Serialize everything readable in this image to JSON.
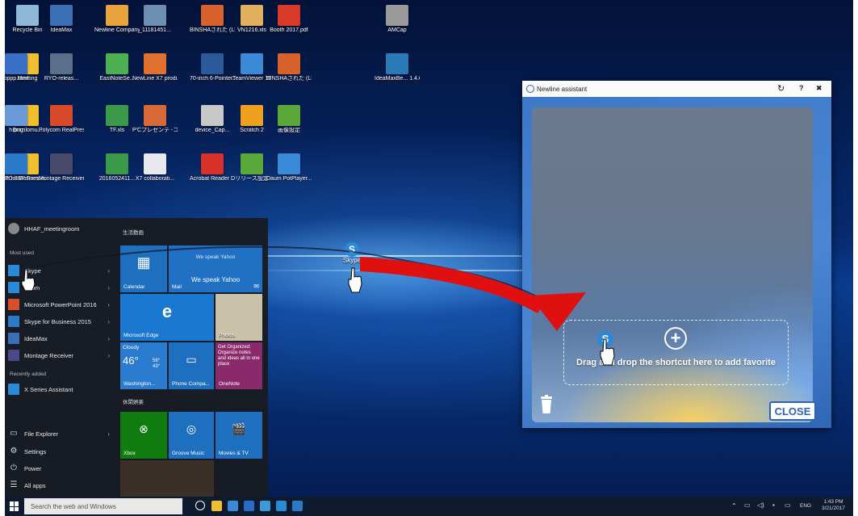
{
  "desktop": {
    "icons": [
      {
        "label": "Recycle Bin",
        "color": "#8fb8d8",
        "col": 0,
        "row": 0
      },
      {
        "label": "IdeaMax",
        "color": "#3a6fb5",
        "col": 1,
        "row": 0
      },
      {
        "label": "Newline Company l...",
        "color": "#e8a33c",
        "col": 2,
        "row": 0
      },
      {
        "label": "_11181451...",
        "color": "#6c8fb0",
        "col": 3,
        "row": 0
      },
      {
        "label": "BINSHAされた (LBG)",
        "color": "#d8622b",
        "col": 4,
        "row": 0
      },
      {
        "label": "VN1216.xls",
        "color": "#e0b060",
        "col": 5,
        "row": 0
      },
      {
        "label": "Booth 2017.pdf",
        "color": "#d83a2a",
        "col": 6,
        "row": 0
      },
      {
        "label": "AMCap",
        "color": "#9a9a9a",
        "col": 8,
        "row": 0
      },
      {
        "label": "Meeting",
        "color": "#f0c030",
        "col": 0,
        "row": 1
      },
      {
        "label": "RYO-releas...",
        "color": "#5a6f8a",
        "col": 1,
        "row": 1
      },
      {
        "label": "EastNoteSe...",
        "color": "#4caf50",
        "col": 2,
        "row": 1
      },
      {
        "label": "NewLine X7 product kit...",
        "color": "#e07030",
        "col": 3,
        "row": 1
      },
      {
        "label": "70-inch 6-Pointer...",
        "color": "#2a5a9a",
        "col": 4,
        "row": 1
      },
      {
        "label": "TeamViewer 12",
        "color": "#3a8ad8",
        "col": 5,
        "row": 1
      },
      {
        "label": "BINSHAされた (LBG)",
        "color": "#d8622b",
        "col": 6,
        "row": 1
      },
      {
        "label": "pppp.html",
        "color": "#3a6fc8",
        "col": 7,
        "row": 1
      },
      {
        "label": "IdeaMaxBe... 1.4.6.2016...",
        "color": "#2a7ab8",
        "col": 8,
        "row": 1
      },
      {
        "label": "Brazilomu...",
        "color": "#f0c030",
        "col": 0,
        "row": 2
      },
      {
        "label": "Polycom RealPresen...",
        "color": "#d84a2a",
        "col": 1,
        "row": 2
      },
      {
        "label": "TF.xls",
        "color": "#3a9a4a",
        "col": 2,
        "row": 2
      },
      {
        "label": "P'Cプレゼンテ -コンコ 2.pptx",
        "color": "#d86a3a",
        "col": 3,
        "row": 2
      },
      {
        "label": "device_Cap...",
        "color": "#c8c8c8",
        "col": 4,
        "row": 2
      },
      {
        "label": "Scratch 2",
        "color": "#f0a020",
        "col": 5,
        "row": 2
      },
      {
        "label": "画像設定",
        "color": "#5aa83a",
        "col": 6,
        "row": 2
      },
      {
        "label": "h.png",
        "color": "#6a9ad8",
        "col": 7,
        "row": 2
      },
      {
        "label": "TC-3BP Firmwa...",
        "color": "#f0c030",
        "col": 0,
        "row": 3
      },
      {
        "label": "Montage Receiver",
        "color": "#4a4a6a",
        "col": 1,
        "row": 3
      },
      {
        "label": "2016052411...",
        "color": "#3a9a4a",
        "col": 2,
        "row": 3
      },
      {
        "label": "X7 collaborati...",
        "color": "#e8e8f0",
        "col": 3,
        "row": 3
      },
      {
        "label": "Acrobat Reader DC",
        "color": "#d8302a",
        "col": 4,
        "row": 3
      },
      {
        "label": "リリース設定",
        "color": "#5aa83a",
        "col": 5,
        "row": 3
      },
      {
        "label": "Daum PotPlayer...",
        "color": "#3a8ad8",
        "col": 6,
        "row": 3
      },
      {
        "label": "Skype for Business 2015",
        "color": "#2a7ac8",
        "col": 7,
        "row": 3
      }
    ],
    "dragged_icon_label": "Skype"
  },
  "start_menu": {
    "user": "HHAF_meetingroom",
    "most_used_header": "Most used",
    "recently_added_header": "Recently added",
    "items": [
      {
        "label": "Skype",
        "color": "#2a8ad8",
        "arrow": "›"
      },
      {
        "label": "Zoom",
        "color": "#2a8ad8",
        "arrow": "›"
      },
      {
        "label": "Microsoft PowerPoint 2016",
        "color": "#d8502a",
        "arrow": "›"
      },
      {
        "label": "Skype for Business 2015",
        "color": "#2a7ac8",
        "arrow": "›"
      },
      {
        "label": "IdeaMax",
        "color": "#3a6fb5",
        "arrow": "›"
      },
      {
        "label": "Montage Receiver",
        "color": "#4a4a8a",
        "arrow": "›"
      }
    ],
    "recent_items": [
      {
        "label": "X Series Assistant",
        "color": "#2a8ad8"
      }
    ],
    "bottom": [
      {
        "label": "File Explorer",
        "arrow": "›"
      },
      {
        "label": "Settings"
      },
      {
        "label": "Power"
      },
      {
        "label": "All apps"
      }
    ],
    "group1_header": "生活動画",
    "group2_header": "休閑娯楽",
    "tiles": {
      "calendar": "Calendar",
      "mail_top": "We speak Yahoo",
      "mail_label": "Mail",
      "mail_big": "We speak Yahoo",
      "edge": "Microsoft Edge",
      "photos": "Photos",
      "weather_title": "Cloudy",
      "weather_temp": "46°",
      "weather_hi": "56°",
      "weather_lo": "43°",
      "weather_city": "Washington...",
      "phone": "Phone Compa...",
      "onenote_text": "Get Organized: Organize notes and ideas all in one place",
      "onenote": "OneNote",
      "xbox": "Xbox",
      "groove": "Groove Music",
      "movies": "Movies & TV"
    }
  },
  "assistant": {
    "title": "Newline assistant",
    "ctrl_refresh": "↻",
    "ctrl_help": "?",
    "ctrl_close": "✖",
    "drop_text": "Drag and drop the shortcut here to add favorite",
    "plus": "+",
    "close_label": "CLOSE"
  },
  "taskbar": {
    "search_placeholder": "Search the web and Windows",
    "lang": "ENG",
    "time": "1:43 PM",
    "date": "3/21/2017",
    "icons": [
      "task-view",
      "file-manager",
      "store",
      "edge",
      "ie",
      "skype",
      "skype-business"
    ],
    "icon_colors": [
      "#ffffff",
      "#f0c030",
      "#3a8ad8",
      "#2a6ac8",
      "#3a9ad8",
      "#2a8ad8",
      "#2a7ac8"
    ]
  },
  "annotation": {
    "arrow_color": "#e01010"
  }
}
